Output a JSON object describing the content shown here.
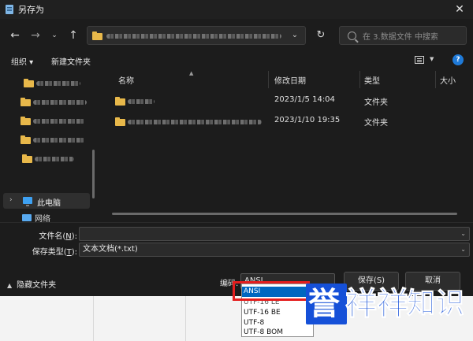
{
  "window": {
    "title": "另存为"
  },
  "search": {
    "placeholder": "在 3.数据文件 中搜索"
  },
  "toolbar": {
    "organize_label": "组织 ▾",
    "new_folder_label": "新建文件夹",
    "help_label": "?"
  },
  "columns": {
    "name": "名称",
    "date": "修改日期",
    "type": "类型",
    "size": "大小"
  },
  "files": [
    {
      "date": "2023/1/5 14:04",
      "type": "文件夹"
    },
    {
      "date": "2023/1/10 19:35",
      "type": "文件夹"
    }
  ],
  "nav": {
    "this_pc": "此电脑",
    "network": "网络"
  },
  "form": {
    "filename_label": "文件名(N):",
    "filename_key": "N",
    "filetype_label_prefix": "保存类型(",
    "filetype_key": "T",
    "filetype_label_suffix": "):",
    "filetype_value": "文本文档(*.txt)",
    "hide_folders_label": "隐藏文件夹",
    "encoding_label": "编码:",
    "encoding_value": "ANSI",
    "save_label": "保存(S)",
    "cancel_label": "取消"
  },
  "encoding_options": [
    "ANSI",
    "UTF-16 LE",
    "UTF-16 BE",
    "UTF-8",
    "UTF-8 BOM"
  ],
  "encoding_selected": "ANSI",
  "watermark": {
    "text": "誉祥祥知识",
    "accent": "#1550d8",
    "text_color": "#1550d8"
  },
  "colors": {
    "dialog_bg": "#1c1c1c",
    "selection": "#0067c0",
    "highlight": "#e41e1e",
    "folder": "#e8b84a"
  }
}
